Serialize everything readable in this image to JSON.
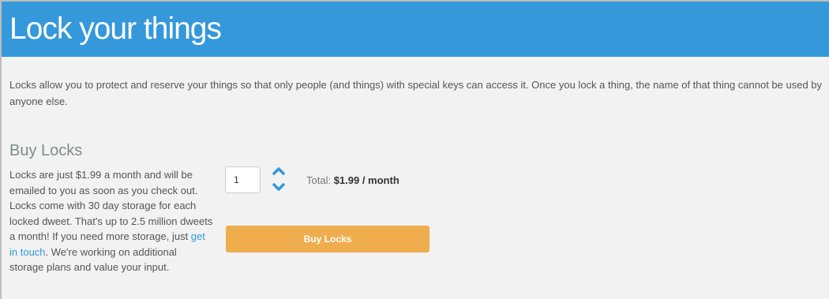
{
  "header": {
    "title": "Lock your things"
  },
  "intro": {
    "text": "Locks allow you to protect and reserve your things so that only people (and things) with special keys can access it. Once you lock a thing, the name of that thing cannot be used by anyone else."
  },
  "buy_section": {
    "title": "Buy Locks",
    "description_before_link": "Locks are just $1.99 a month and will be emailed to you as soon as you check out. Locks come with 30 day storage for each locked dweet. That's up to 2.5 million dweets a month! If you need more storage, just ",
    "link_text": "get in touch",
    "description_after_link": ". We're working on additional storage plans and value your input.",
    "quantity_value": "1",
    "total_label": "Total: ",
    "total_value": "$1.99 / month",
    "buy_button_label": "Buy Locks"
  },
  "icons": {
    "increment": "chevron-up-icon",
    "decrement": "chevron-down-icon"
  },
  "colors": {
    "banner": "#3498db",
    "link": "#3498db",
    "stepper_arrows": "#3498db",
    "buy_button": "#f0ad4e",
    "page_background": "#f2f2f2"
  }
}
